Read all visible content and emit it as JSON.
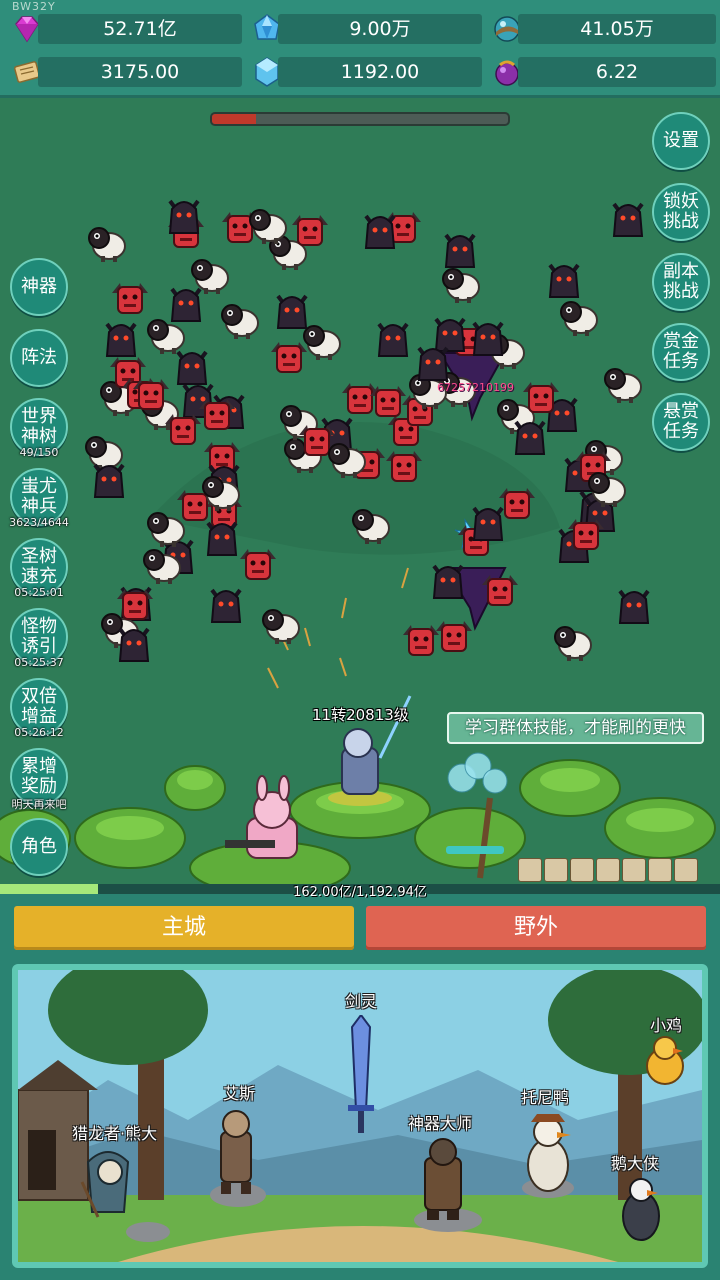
{
  "app": {
    "version_tag": "BW32Y"
  },
  "resources": [
    {
      "icon": "gem-icon",
      "value": "52.71亿"
    },
    {
      "icon": "blue-crystal-icon",
      "value": "9.00万"
    },
    {
      "icon": "orb-icon",
      "value": "41.05万"
    },
    {
      "icon": "scroll-icon",
      "value": "3175.00"
    },
    {
      "icon": "ice-crystal-icon",
      "value": "1192.00"
    },
    {
      "icon": "purple-potion-icon",
      "value": "6.22"
    }
  ],
  "boss_hp_fraction": 0.15,
  "right_menu": [
    {
      "label": "设置"
    },
    {
      "label": "锁妖挑战"
    },
    {
      "label": "副本挑战"
    },
    {
      "label": "赏金任务"
    },
    {
      "label": "悬赏任务"
    }
  ],
  "left_menu": [
    {
      "label": "神器",
      "sub": ""
    },
    {
      "label": "阵法",
      "sub": ""
    },
    {
      "label": "世界神树",
      "sub": "49/150"
    },
    {
      "label": "蚩尤神兵",
      "sub": "3623/4644"
    },
    {
      "label": "圣树速充",
      "sub": "05:25:01"
    },
    {
      "label": "怪物诱引",
      "sub": "05:25:37"
    },
    {
      "label": "双倍增益",
      "sub": "05:26:12"
    },
    {
      "label": "累增奖励",
      "sub": "明天再来吧"
    },
    {
      "label": "角色",
      "sub": ""
    }
  ],
  "battle": {
    "player_level": "11转20813级",
    "damage_number": "67257210199",
    "hint": "学习群体技能，才能刷的更快",
    "exp_text": "162.00亿/1,192.94亿",
    "exp_fraction": 0.136
  },
  "tabs": {
    "city": "主城",
    "wild": "野外"
  },
  "npcs": [
    {
      "name": "剑灵"
    },
    {
      "name": "小鸡"
    },
    {
      "name": "艾斯"
    },
    {
      "name": "托尼鸭"
    },
    {
      "name": "神器大师"
    },
    {
      "name": "猎龙者·熊大"
    },
    {
      "name": "鹅大侠"
    }
  ],
  "colors": {
    "city_tab": "#e5b129",
    "wild_tab": "#df6452",
    "button_teal": "#1f8a78",
    "hp_red": "#c0392b",
    "exp_green": "#a6e87a"
  }
}
